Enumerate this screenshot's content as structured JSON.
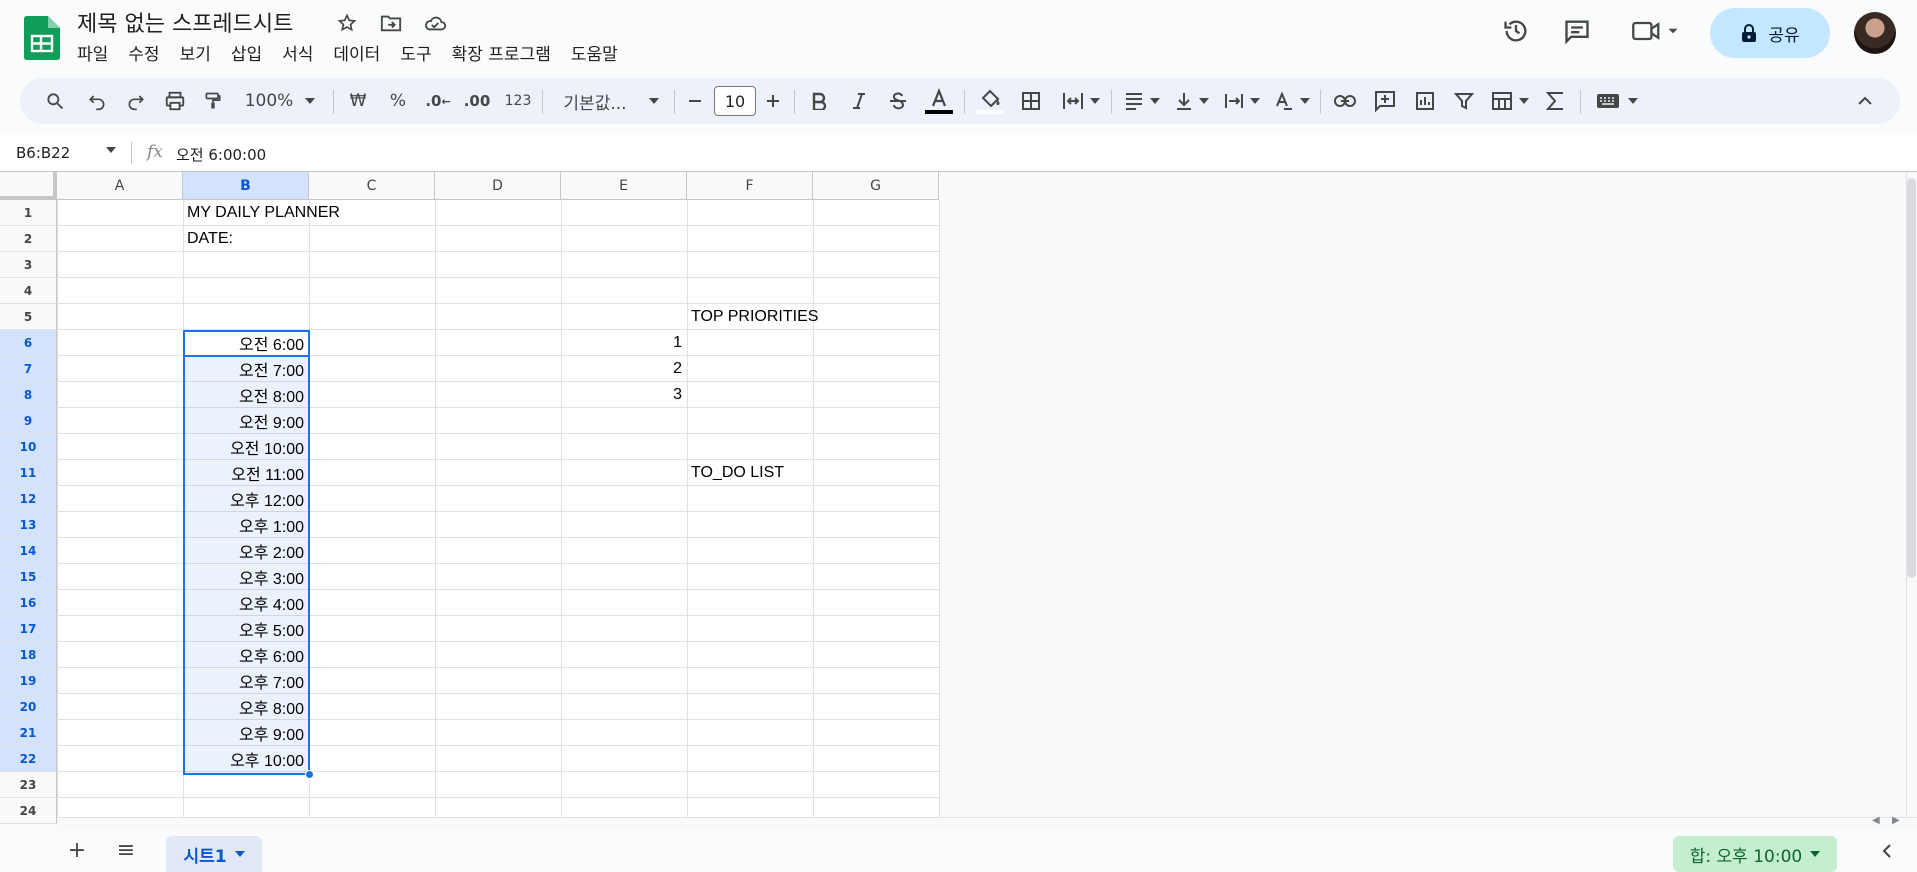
{
  "app": {
    "title": "제목 없는 스프레드시트",
    "menu": [
      "파일",
      "수정",
      "보기",
      "삽입",
      "서식",
      "데이터",
      "도구",
      "확장 프로그램",
      "도움말"
    ],
    "share_label": "공유",
    "brand_color": "#0f9d58",
    "accent_color": "#1a73e8"
  },
  "toolbar": {
    "zoom": "100%",
    "currency": "₩",
    "percent": "%",
    "decrease_decimal": ".0",
    "increase_decimal": ".00",
    "number_format": "123",
    "font_family": "기본값...",
    "font_size": "10"
  },
  "formula_bar": {
    "name_box": "B6:B22",
    "fx": "fx",
    "value": "오전 6:00:00"
  },
  "grid": {
    "columns": [
      "A",
      "B",
      "C",
      "D",
      "E",
      "F",
      "G"
    ],
    "rows": [
      "1",
      "2",
      "3",
      "4",
      "5",
      "6",
      "7",
      "8",
      "9",
      "10",
      "11",
      "12",
      "13",
      "14",
      "15",
      "16",
      "17",
      "18",
      "19",
      "20",
      "21",
      "22",
      "23",
      "24"
    ],
    "selected_column": "B",
    "cells": {
      "B1": "MY DAILY PLANNER",
      "B2": "DATE:",
      "F5": "TOP PRIORITIES",
      "E6": "1",
      "E7": "2",
      "E8": "3",
      "F11": "TO_DO LIST",
      "times": [
        "오전 6:00",
        "오전 7:00",
        "오전 8:00",
        "오전 9:00",
        "오전 10:00",
        "오전 11:00",
        "오후 12:00",
        "오후 1:00",
        "오후 2:00",
        "오후 3:00",
        "오후 4:00",
        "오후 5:00",
        "오후 6:00",
        "오후 7:00",
        "오후 8:00",
        "오후 9:00",
        "오후 10:00"
      ]
    }
  },
  "bottom": {
    "add_sheet": "+",
    "all_sheets": "≡",
    "sheet_tab": "시트1",
    "sum_label": "합: 오후 10:00"
  }
}
